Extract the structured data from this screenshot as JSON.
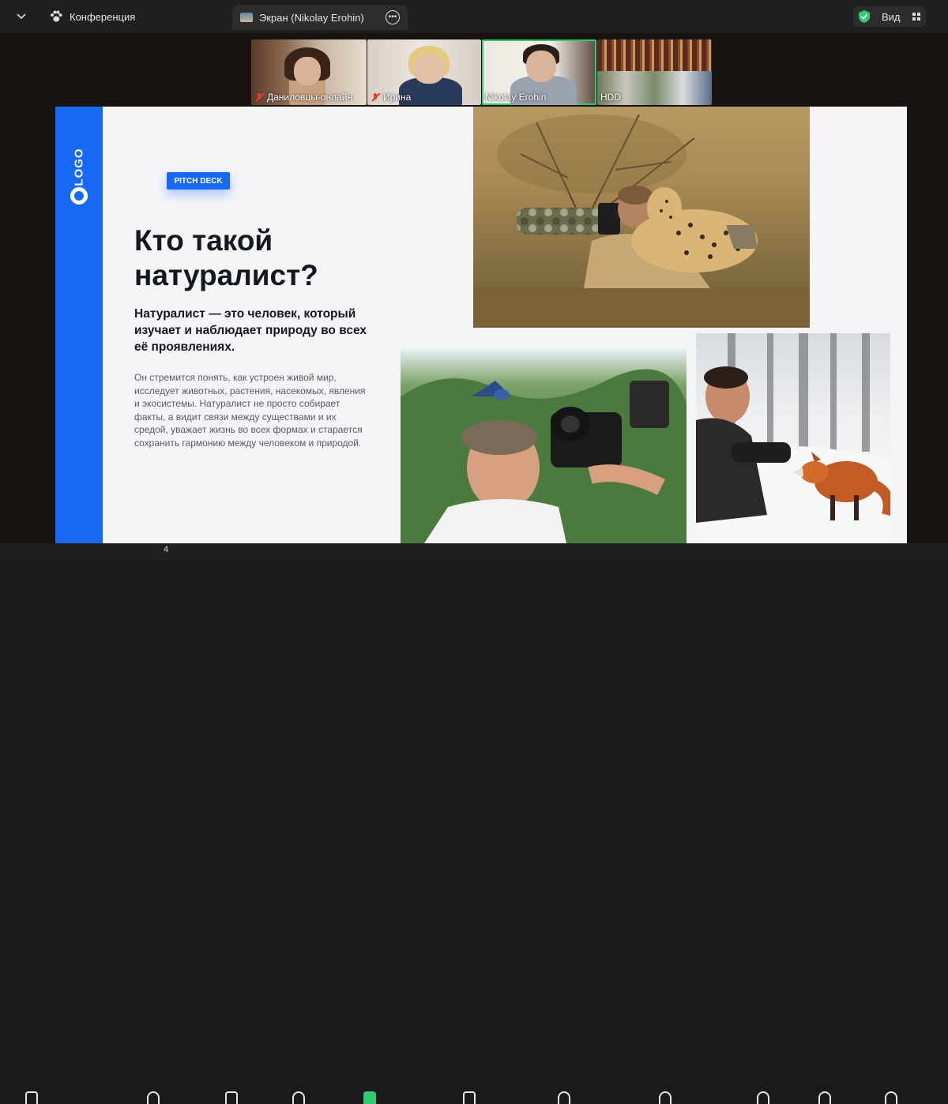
{
  "topbar": {
    "conference_label": "Конференция",
    "screen_tab_label": "Экран (Nikolay Erohin)",
    "view_label": "Вид"
  },
  "participants": [
    {
      "name": "Даниловцы-онлайн",
      "muted": true
    },
    {
      "name": "Ирина",
      "muted": true
    },
    {
      "name": "Nikolay Erohin",
      "muted": false,
      "active_speaker": true
    },
    {
      "name": "HDD",
      "muted": false
    }
  ],
  "slide": {
    "logo_text": "LOGO",
    "badge": "PITCH DECK",
    "title": "Кто такой натуралист?",
    "lead": "Натуралист — это человек, который изучает и наблюдает природу во всех её проявлениях.",
    "body": "Он стремится понять, как устроен живой мир, исследует животных, растения, насекомых, явления и экосистемы. Натуралист не просто собирает факты, а видит связи между существами и их средой, уважает жизнь во всех формах и старается сохранить гармонию между человеком и природой."
  },
  "bottombar": {
    "participant_count": "4"
  },
  "colors": {
    "accent_blue": "#1668f5",
    "active_speaker": "#2ecc71",
    "muted_red": "#e53935"
  }
}
